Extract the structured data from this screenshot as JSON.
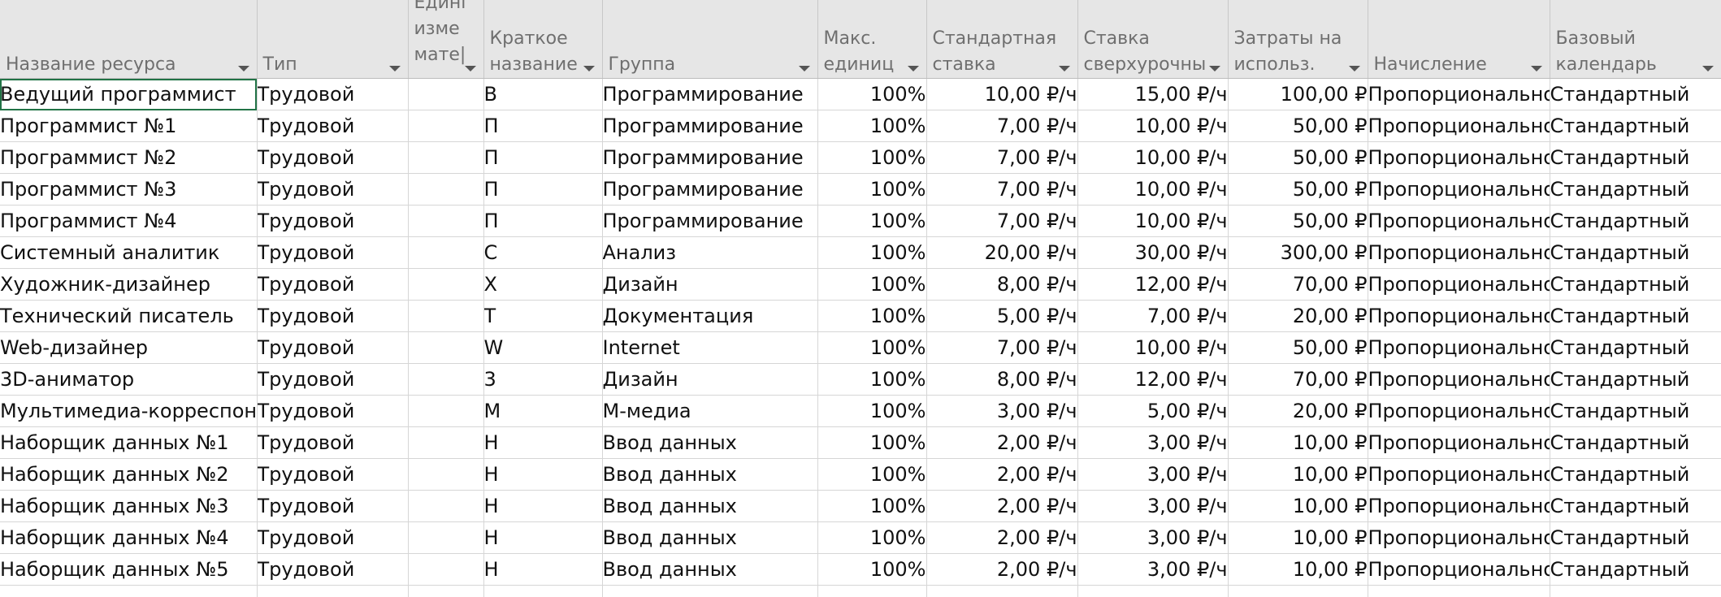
{
  "columns": [
    {
      "key": "name",
      "label": "Название ресурса"
    },
    {
      "key": "type",
      "label": "Тип"
    },
    {
      "key": "unit",
      "label": "Единицы измерения материалов",
      "visible_label": "Едині изме мате|"
    },
    {
      "key": "short",
      "label": "Краткое название"
    },
    {
      "key": "group",
      "label": "Группа"
    },
    {
      "key": "max",
      "label": "Макс. единиц"
    },
    {
      "key": "std",
      "label": "Стандартная ставка"
    },
    {
      "key": "ovt",
      "label": "Ставка сверхурочны"
    },
    {
      "key": "use",
      "label": "Затраты на использ."
    },
    {
      "key": "accrual",
      "label": "Начисление"
    },
    {
      "key": "cal",
      "label": "Базовый календарь"
    }
  ],
  "rows": [
    {
      "name": "Ведущий программист",
      "type": "Трудовой",
      "unit": "",
      "short": "В",
      "group": "Программирование",
      "max": "100%",
      "std": "10,00 ₽/ч",
      "ovt": "15,00 ₽/ч",
      "use": "100,00 ₽",
      "accrual": "Пропорционально",
      "cal": "Стандартный"
    },
    {
      "name": "Программист №1",
      "type": "Трудовой",
      "unit": "",
      "short": "П",
      "group": "Программирование",
      "max": "100%",
      "std": "7,00 ₽/ч",
      "ovt": "10,00 ₽/ч",
      "use": "50,00 ₽",
      "accrual": "Пропорционально",
      "cal": "Стандартный"
    },
    {
      "name": "Программист №2",
      "type": "Трудовой",
      "unit": "",
      "short": "П",
      "group": "Программирование",
      "max": "100%",
      "std": "7,00 ₽/ч",
      "ovt": "10,00 ₽/ч",
      "use": "50,00 ₽",
      "accrual": "Пропорционально",
      "cal": "Стандартный"
    },
    {
      "name": "Программист №3",
      "type": "Трудовой",
      "unit": "",
      "short": "П",
      "group": "Программирование",
      "max": "100%",
      "std": "7,00 ₽/ч",
      "ovt": "10,00 ₽/ч",
      "use": "50,00 ₽",
      "accrual": "Пропорционально",
      "cal": "Стандартный"
    },
    {
      "name": "Программист №4",
      "type": "Трудовой",
      "unit": "",
      "short": "П",
      "group": "Программирование",
      "max": "100%",
      "std": "7,00 ₽/ч",
      "ovt": "10,00 ₽/ч",
      "use": "50,00 ₽",
      "accrual": "Пропорционально",
      "cal": "Стандартный"
    },
    {
      "name": "Системный аналитик",
      "type": "Трудовой",
      "unit": "",
      "short": "С",
      "group": "Анализ",
      "max": "100%",
      "std": "20,00 ₽/ч",
      "ovt": "30,00 ₽/ч",
      "use": "300,00 ₽",
      "accrual": "Пропорционально",
      "cal": "Стандартный"
    },
    {
      "name": "Художник-дизайнер",
      "type": "Трудовой",
      "unit": "",
      "short": "Х",
      "group": "Дизайн",
      "max": "100%",
      "std": "8,00 ₽/ч",
      "ovt": "12,00 ₽/ч",
      "use": "70,00 ₽",
      "accrual": "Пропорционально",
      "cal": "Стандартный"
    },
    {
      "name": "Технический писатель",
      "type": "Трудовой",
      "unit": "",
      "short": "Т",
      "group": "Документация",
      "max": "100%",
      "std": "5,00 ₽/ч",
      "ovt": "7,00 ₽/ч",
      "use": "20,00 ₽",
      "accrual": "Пропорционально",
      "cal": "Стандартный"
    },
    {
      "name": "Web-дизайнер",
      "type": "Трудовой",
      "unit": "",
      "short": "W",
      "group": "Internet",
      "max": "100%",
      "std": "7,00 ₽/ч",
      "ovt": "10,00 ₽/ч",
      "use": "50,00 ₽",
      "accrual": "Пропорционально",
      "cal": "Стандартный"
    },
    {
      "name": "3D-аниматор",
      "type": "Трудовой",
      "unit": "",
      "short": "3",
      "group": "Дизайн",
      "max": "100%",
      "std": "8,00 ₽/ч",
      "ovt": "12,00 ₽/ч",
      "use": "70,00 ₽",
      "accrual": "Пропорционально",
      "cal": "Стандартный"
    },
    {
      "name": "Мультимедиа-корреспондент",
      "type": "Трудовой",
      "unit": "",
      "short": "М",
      "group": "М-медиа",
      "max": "100%",
      "std": "3,00 ₽/ч",
      "ovt": "5,00 ₽/ч",
      "use": "20,00 ₽",
      "accrual": "Пропорционально",
      "cal": "Стандартный"
    },
    {
      "name": "Наборщик данных №1",
      "type": "Трудовой",
      "unit": "",
      "short": "Н",
      "group": "Ввод данных",
      "max": "100%",
      "std": "2,00 ₽/ч",
      "ovt": "3,00 ₽/ч",
      "use": "10,00 ₽",
      "accrual": "Пропорционально",
      "cal": "Стандартный"
    },
    {
      "name": "Наборщик данных №2",
      "type": "Трудовой",
      "unit": "",
      "short": "Н",
      "group": "Ввод данных",
      "max": "100%",
      "std": "2,00 ₽/ч",
      "ovt": "3,00 ₽/ч",
      "use": "10,00 ₽",
      "accrual": "Пропорционально",
      "cal": "Стандартный"
    },
    {
      "name": "Наборщик данных №3",
      "type": "Трудовой",
      "unit": "",
      "short": "Н",
      "group": "Ввод данных",
      "max": "100%",
      "std": "2,00 ₽/ч",
      "ovt": "3,00 ₽/ч",
      "use": "10,00 ₽",
      "accrual": "Пропорционально",
      "cal": "Стандартный"
    },
    {
      "name": "Наборщик данных №4",
      "type": "Трудовой",
      "unit": "",
      "short": "Н",
      "group": "Ввод данных",
      "max": "100%",
      "std": "2,00 ₽/ч",
      "ovt": "3,00 ₽/ч",
      "use": "10,00 ₽",
      "accrual": "Пропорционально",
      "cal": "Стандартный"
    },
    {
      "name": "Наборщик данных №5",
      "type": "Трудовой",
      "unit": "",
      "short": "Н",
      "group": "Ввод данных",
      "max": "100%",
      "std": "2,00 ₽/ч",
      "ovt": "3,00 ₽/ч",
      "use": "10,00 ₽",
      "accrual": "Пропорционально",
      "cal": "Стандартный"
    }
  ]
}
